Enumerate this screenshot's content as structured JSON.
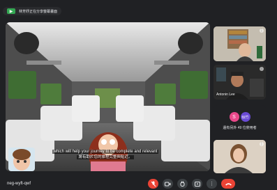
{
  "presenting_label": "林芳妤正在分享螢幕畫面",
  "captions": {
    "english": "which will help your journey to be complete and relevant",
    "chinese": "將有助於您的旅程完整與貼近。"
  },
  "participants": {
    "tile2_name": "Antonin Lee",
    "avatar_initial": "S",
    "avatar_name": "似竹",
    "others_text": "還有另外 49 位使用者"
  },
  "meeting_code": "neg-wyft-qwf",
  "icons": {
    "mic": "mic-off-icon",
    "camera": "camera-icon",
    "hand": "raise-hand-icon",
    "present": "present-icon",
    "more": "more-options-icon",
    "end": "end-call-icon"
  },
  "colors": {
    "background": "#202124",
    "end_call": "#ea4335",
    "present_green": "#34a853"
  }
}
